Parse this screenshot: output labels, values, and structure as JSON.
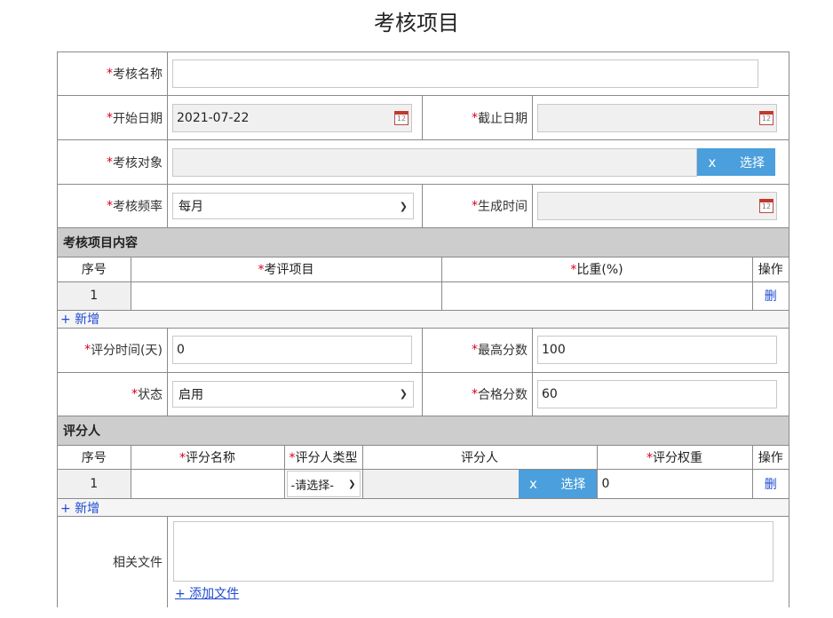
{
  "page": {
    "title": "考核项目"
  },
  "form": {
    "name_label": "考核名称",
    "start_date_label": "开始日期",
    "start_date_value": "2021-07-22",
    "end_date_label": "截止日期",
    "target_label": "考核对象",
    "frequency_label": "考核频率",
    "frequency_value": "每月",
    "gen_time_label": "生成时间",
    "select_label": "选择",
    "clear_glyph": "x",
    "req_mark": "*",
    "calendar_glyph": "12"
  },
  "content_section": {
    "title": "考核项目内容",
    "columns": {
      "index": "序号",
      "item": "考评项目",
      "weight": "比重(%)",
      "action": "操作"
    },
    "rows": [
      {
        "index": "1",
        "item": "",
        "weight": "",
        "action": "删"
      }
    ],
    "add_label": "+ 新增"
  },
  "settings": {
    "score_time_label": "评分时间(天)",
    "score_time_value": "0",
    "max_score_label": "最高分数",
    "max_score_value": "100",
    "status_label": "状态",
    "status_value": "启用",
    "pass_score_label": "合格分数",
    "pass_score_value": "60"
  },
  "raters_section": {
    "title": "评分人",
    "columns": {
      "index": "序号",
      "name": "评分名称",
      "type": "评分人类型",
      "rater": "评分人",
      "weight": "评分权重",
      "action": "操作"
    },
    "rows": [
      {
        "index": "1",
        "name": "",
        "type": "-请选择-",
        "rater": "",
        "weight": "0",
        "action": "删"
      }
    ],
    "add_label": "+ 新增"
  },
  "files": {
    "label": "相关文件",
    "add_label": "+ 添加文件"
  }
}
